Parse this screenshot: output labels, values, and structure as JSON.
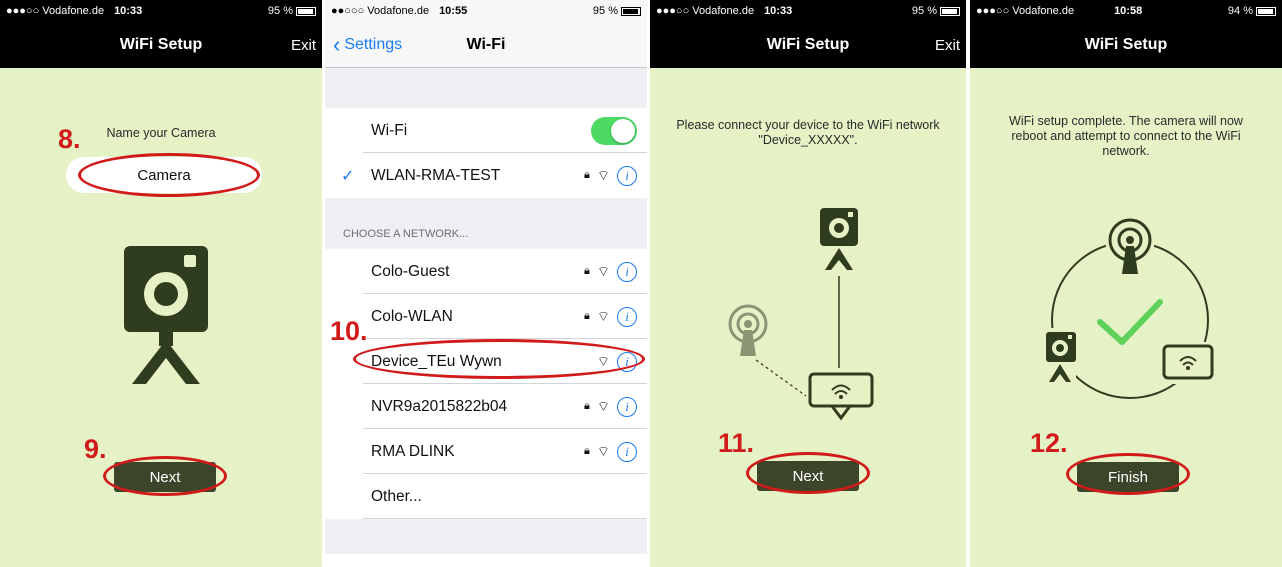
{
  "colors": {
    "app_bg": "#e4f2c6",
    "app_dark": "#000000",
    "camera_green": "#2f3d1e",
    "accent_red": "#d11b1b",
    "ios_blue": "#1a7cf5",
    "ios_toggle": "#4cd964",
    "check_green": "#5fd15a"
  },
  "screens": [
    {
      "status": {
        "carrier": "●●●○○ Vodafone.de",
        "time": "10:33",
        "battery": "95 %"
      },
      "nav": {
        "title": "WiFi Setup",
        "exit": "Exit"
      },
      "name_label": "Name your Camera",
      "name_value": "Camera",
      "step_name": "8.",
      "step_next": "9.",
      "button": "Next",
      "icon": "camera-tripod-icon"
    },
    {
      "status": {
        "carrier": "●●○○○ Vodafone.de",
        "time": "10:55",
        "battery": "95 %"
      },
      "nav": {
        "back": "Settings",
        "title": "Wi-Fi"
      },
      "wifi_label": "Wi-Fi",
      "connected": "WLAN-RMA-TEST",
      "section": "CHOOSE A NETWORK...",
      "networks": [
        {
          "name": "Colo-Guest",
          "locked": true
        },
        {
          "name": "Colo-WLAN",
          "locked": true
        },
        {
          "name": "Device_TEu  Wywn",
          "locked": false
        },
        {
          "name": "NVR9a2015822b04",
          "locked": true
        },
        {
          "name": "RMA DLINK",
          "locked": true
        },
        {
          "name": "Other...",
          "locked": false
        }
      ],
      "step": "10."
    },
    {
      "status": {
        "carrier": "●●●○○ Vodafone.de",
        "time": "10:33",
        "battery": "95 %"
      },
      "nav": {
        "title": "WiFi Setup",
        "exit": "Exit"
      },
      "message": "Please connect your device to the WiFi network \"Device_XXXXX\".",
      "step": "11.",
      "button": "Next"
    },
    {
      "status": {
        "carrier": "●●●○○ Vodafone.de",
        "time": "10:58",
        "battery": "94 %"
      },
      "nav": {
        "title": "WiFi Setup"
      },
      "message": "WiFi setup complete. The camera will now reboot and attempt to connect to the WiFi network.",
      "step": "12.",
      "button": "Finish"
    }
  ]
}
